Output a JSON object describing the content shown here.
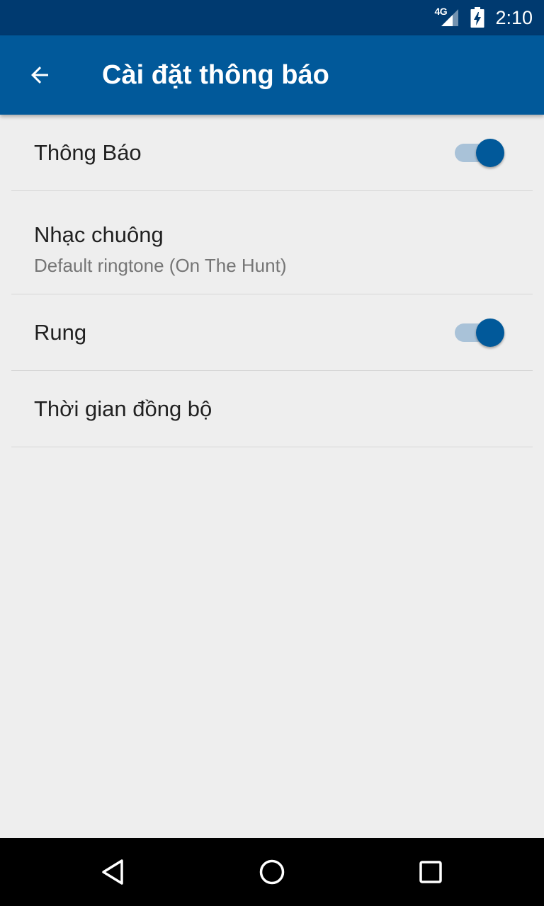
{
  "status_bar": {
    "network": "4G",
    "time": "2:10",
    "icons": [
      "signal-icon",
      "battery-charging-icon"
    ]
  },
  "app_bar": {
    "title": "Cài đặt thông báo",
    "back_icon": "arrow-back-icon",
    "colors": {
      "status_bar": "#003a70",
      "app_bar": "#01599a"
    }
  },
  "settings": {
    "notifications": {
      "title": "Thông Báo",
      "enabled": true
    },
    "ringtone": {
      "title": "Nhạc chuông",
      "value": "Default ringtone (On The Hunt)"
    },
    "vibrate": {
      "title": "Rung",
      "enabled": true
    },
    "sync_time": {
      "title": "Thời gian đồng bộ"
    }
  },
  "nav_bar": {
    "icons": [
      "back-triangle-icon",
      "home-circle-icon",
      "recents-square-icon"
    ]
  },
  "colors": {
    "accent": "#01599a",
    "switch_track_on": "#a9c2d8",
    "background": "#eeeeee",
    "divider": "#d6d6d6"
  }
}
